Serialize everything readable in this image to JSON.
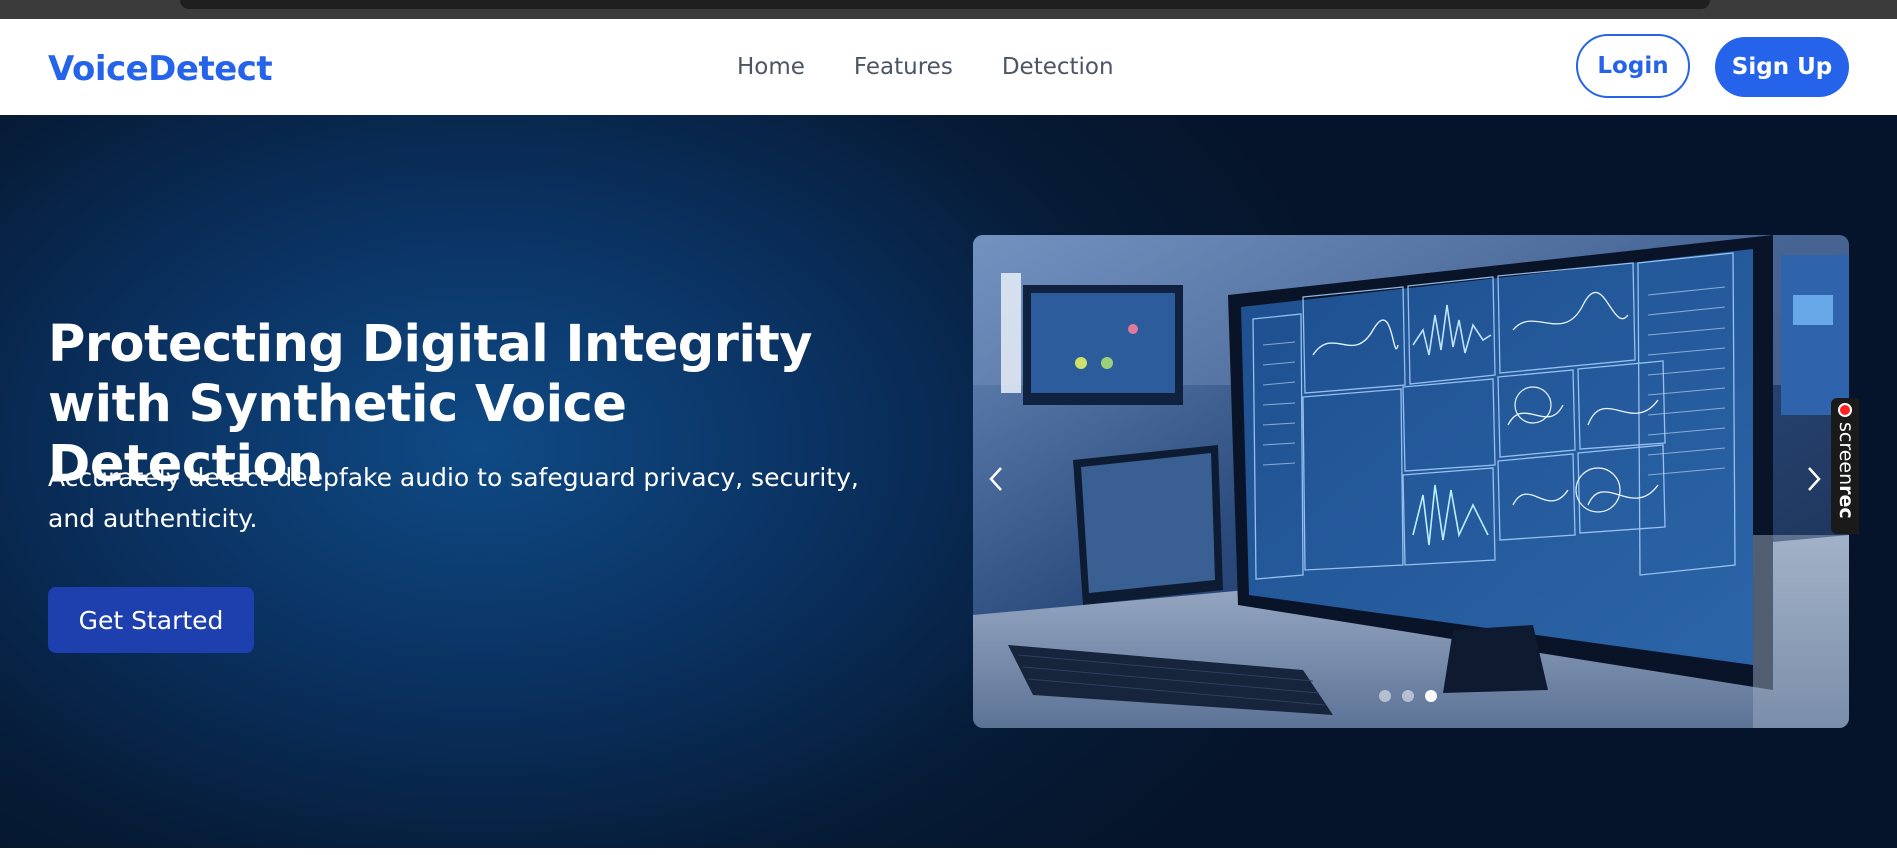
{
  "brand": {
    "name": "VoiceDetect",
    "color": "#2563eb"
  },
  "nav": {
    "links": [
      "Home",
      "Features",
      "Detection"
    ],
    "login_label": "Login",
    "signup_label": "Sign Up"
  },
  "hero": {
    "title": "Protecting Digital Integrity with Synthetic Voice Detection",
    "subtitle": "Accurately detect deepfake audio to safeguard privacy, security, and authenticity.",
    "cta_label": "Get Started"
  },
  "carousel": {
    "slide_count": 3,
    "active_slide": 3,
    "image_icon": "computer-monitor-data-visualization",
    "prev_icon": "chevron-left-icon",
    "next_icon": "chevron-right-icon"
  },
  "recording_overlay": {
    "prefix": "screen",
    "suffix": "rec"
  }
}
